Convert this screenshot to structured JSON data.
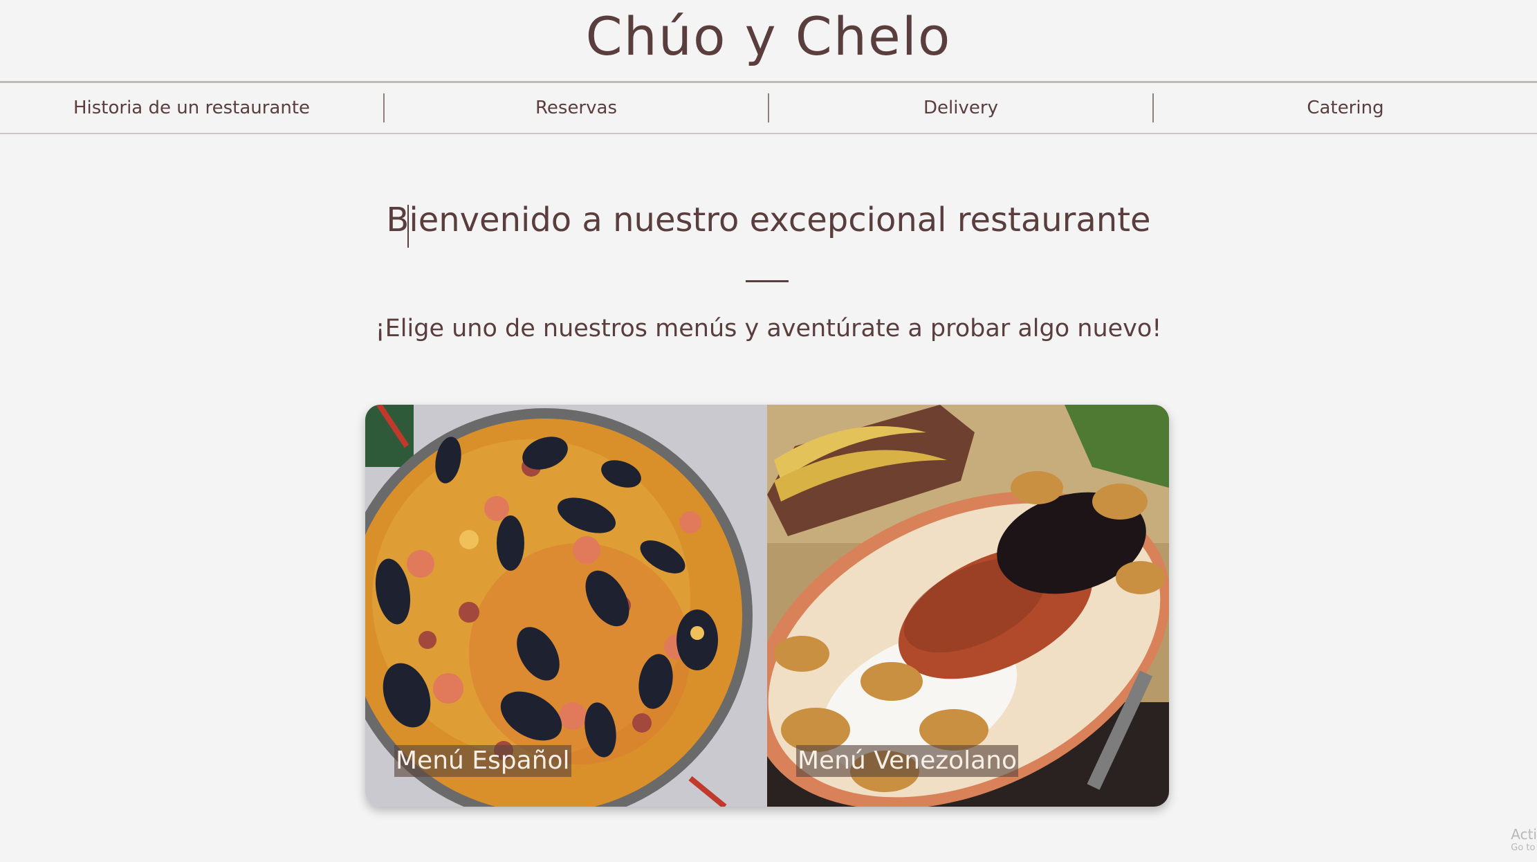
{
  "header": {
    "title": "Chúo y Chelo"
  },
  "nav": {
    "items": [
      {
        "label": "Historia de un restaurante"
      },
      {
        "label": "Reservas"
      },
      {
        "label": "Delivery"
      },
      {
        "label": "Catering"
      }
    ]
  },
  "hero": {
    "title": "Bienvenido a nuestro excepcional restaurante",
    "subtitle": "¡Elige uno de nuestros menús y aventúrate a probar algo nuevo!"
  },
  "menus": [
    {
      "label": "Menú Español",
      "image": "paella-image"
    },
    {
      "label": "Menú Venezolano",
      "image": "pabellon-criollo-image"
    }
  ],
  "watermark": {
    "text": "Acti",
    "sub": "Go to"
  },
  "colors": {
    "text": "#5a3d3d",
    "background": "#f4f4f4"
  }
}
